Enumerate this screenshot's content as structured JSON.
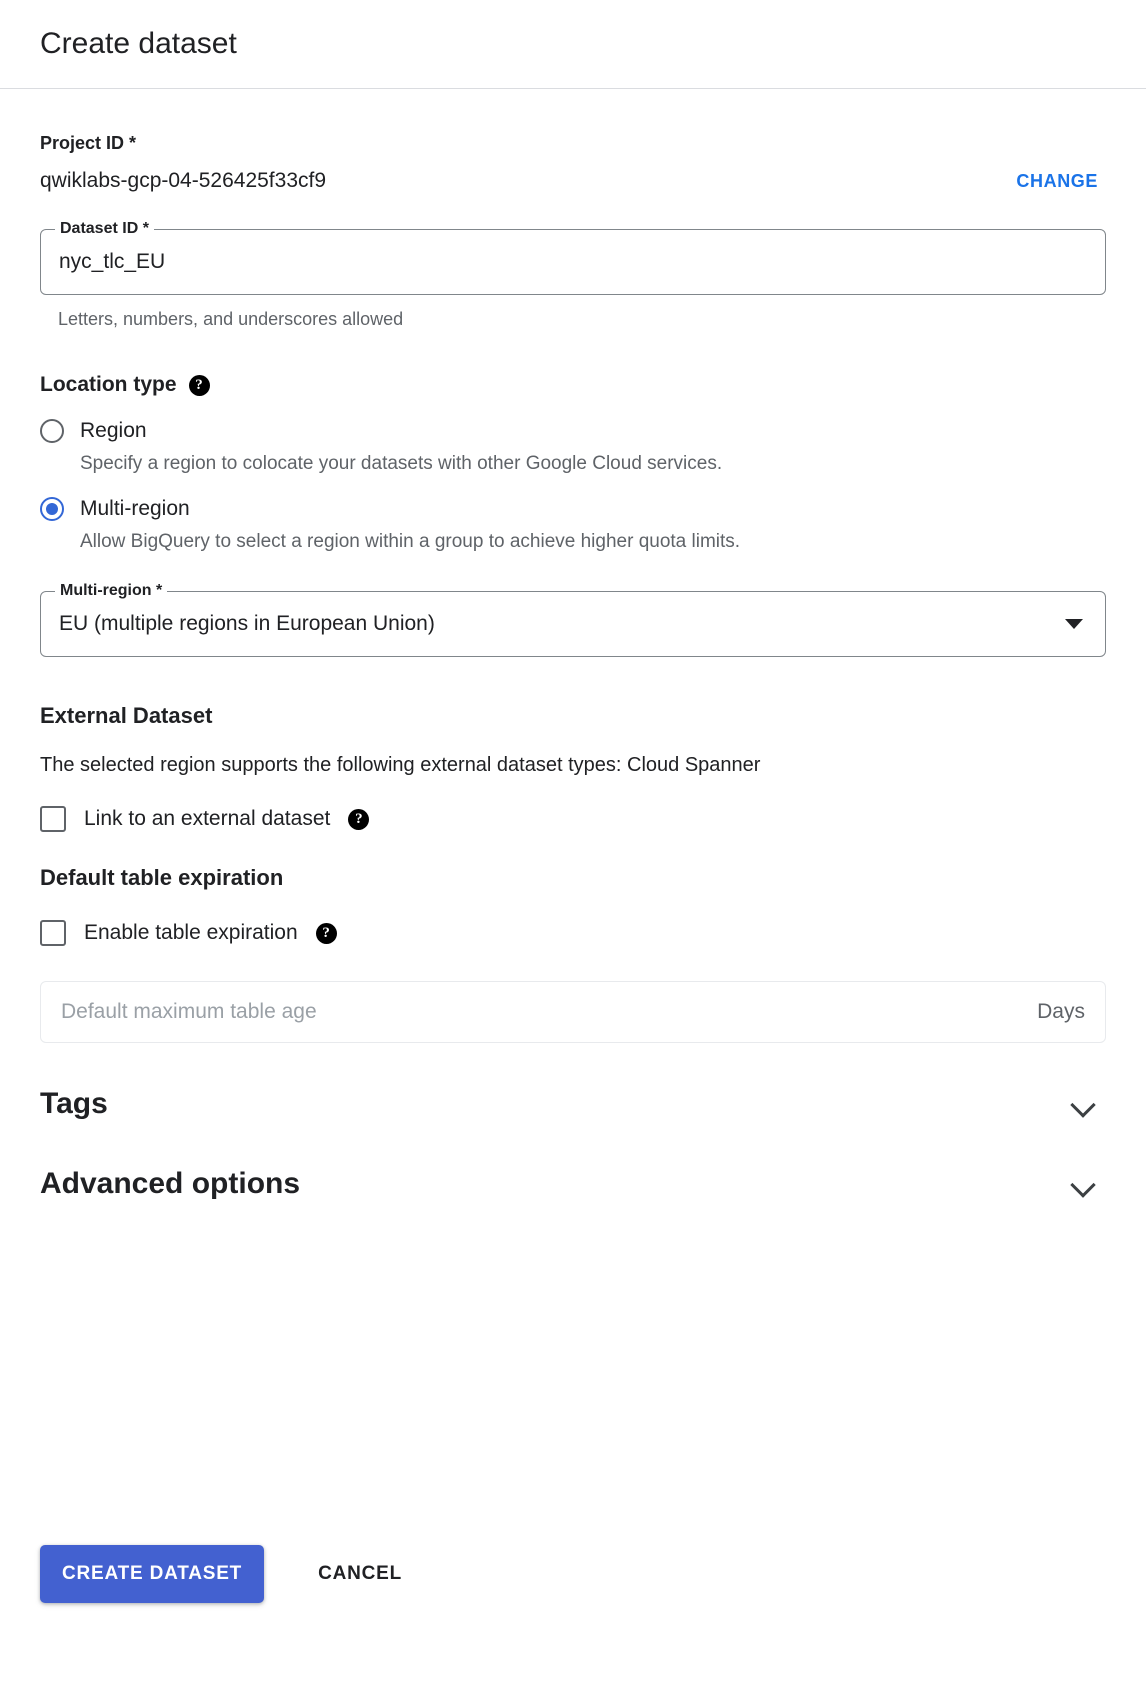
{
  "header": {
    "title": "Create dataset"
  },
  "project": {
    "label": "Project ID *",
    "value": "qwiklabs-gcp-04-526425f33cf9",
    "change_label": "CHANGE"
  },
  "dataset_id": {
    "legend": "Dataset ID *",
    "value": "nyc_tlc_EU",
    "hint": "Letters, numbers, and underscores allowed"
  },
  "location_type": {
    "title": "Location type",
    "help_glyph": "?",
    "options": [
      {
        "label": "Region",
        "description": "Specify a region to colocate your datasets with other Google Cloud services.",
        "selected": false
      },
      {
        "label": "Multi-region",
        "description": "Allow BigQuery to select a region within a group to achieve higher quota limits.",
        "selected": true
      }
    ]
  },
  "multi_region_select": {
    "legend": "Multi-region *",
    "value": "EU (multiple regions in European Union)"
  },
  "external_dataset": {
    "title": "External Dataset",
    "description": "The selected region supports the following external dataset types: Cloud Spanner",
    "checkbox_label": "Link to an external dataset",
    "checked": false,
    "help_glyph": "?"
  },
  "table_expiration": {
    "title": "Default table expiration",
    "checkbox_label": "Enable table expiration",
    "checked": false,
    "help_glyph": "?",
    "age_placeholder": "Default maximum table age",
    "age_value": "",
    "age_suffix": "Days"
  },
  "expanders": [
    {
      "title": "Tags",
      "expanded": false
    },
    {
      "title": "Advanced options",
      "expanded": false
    }
  ],
  "actions": {
    "primary_label": "CREATE DATASET",
    "secondary_label": "CANCEL"
  },
  "colors": {
    "accent_blue": "#1a73e8",
    "primary_button": "#4361d0",
    "radio_selected": "#3367d6",
    "divider": "#dadce0",
    "muted_text": "#5f6368",
    "placeholder_text": "#9aa0a6"
  }
}
